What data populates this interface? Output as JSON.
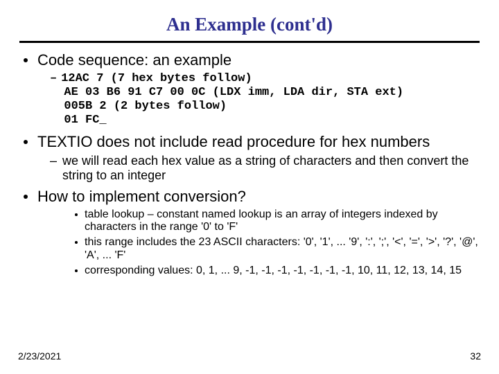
{
  "title": "An Example (cont'd)",
  "b1_a": "Code sequence: an example",
  "code_l1": "12AC 7 (7 hex bytes follow)",
  "code_l2": "AE 03 B6 91 C7 00 0C (LDX imm, LDA dir, STA ext)",
  "code_l3": "005B 2 (2 bytes follow)",
  "code_l4": "01 FC_",
  "b1_b": "TEXTIO does not include read procedure for hex numbers",
  "b2_a": "we will read each hex value as a string of characters and then convert the string to an integer",
  "b1_c": "How to implement conversion?",
  "b3_a": "table lookup – constant named lookup is an array of integers indexed by characters in the range '0' to 'F'",
  "b3_b": "this range includes the 23 ASCII characters: '0', '1', ... '9', ':', ';', '<', '=', '>', '?', '@', 'A', ... 'F'",
  "b3_c": "corresponding values: 0, 1, ... 9, -1, -1, -1, -1, -1, -1, -1, 10, 11, 12, 13, 14, 15",
  "footer": {
    "date": "2/23/2021",
    "page": "32"
  }
}
